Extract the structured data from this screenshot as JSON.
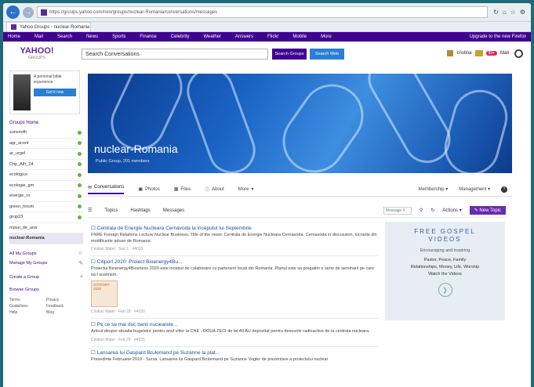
{
  "browser": {
    "url": "https://groups.yahoo.com/neo/groups/nuclear-Romania/conversations/messages",
    "tab_title": "Yahoo Groups - nuclear-Romania",
    "back_icon": "back-arrow-icon",
    "forward_icon": "forward-arrow-icon"
  },
  "ynav": {
    "items": [
      "Home",
      "Mail",
      "Search",
      "News",
      "Sports",
      "Finance",
      "Celebrity",
      "Weather",
      "Answers",
      "Flickr",
      "Mobile",
      "More"
    ],
    "right_text": "Upgrade to the new Firefox"
  },
  "header": {
    "logo": "YAHOO!",
    "logo_sub": "GROUPS",
    "search_value": "Search Conversations",
    "search_groups_label": "Search Groups",
    "search_web_label": "Search Web",
    "user_name": "cristina",
    "mail_count": "99+",
    "mail_label": "Mail"
  },
  "sidebar": {
    "ad_text": "A personal bible experience",
    "ad_button": "Get it now",
    "groups_heading": "Groups Home",
    "groups": [
      {
        "name": "sunsnoflr",
        "dot": true
      },
      {
        "name": "agr_aconf",
        "dot": true
      },
      {
        "name": "ar_urgel",
        "dot": true
      },
      {
        "name": "Cnp_Alfr_24",
        "dot": true
      },
      {
        "name": "ecologice",
        "dot": true
      },
      {
        "name": "ecologie_gm",
        "dot": true
      },
      {
        "name": "energie_ro",
        "dot": true
      },
      {
        "name": "green_forum",
        "dot": true
      },
      {
        "name": "grup23",
        "dot": true
      },
      {
        "name": "mpuri_de_ana",
        "dot": false
      },
      {
        "name": "nuclear-Romania",
        "dot": false,
        "active": true
      }
    ],
    "all_groups": "All My Groups",
    "manage_groups": "Manage My Groups",
    "create_group": "Create a Group",
    "browse_groups": "Browse Groups",
    "footer": [
      "Terms",
      "Privacy",
      "Guidelines",
      "Feedback",
      "Help",
      "Blog"
    ]
  },
  "cover": {
    "title": "nuclear-Romania",
    "meta": "Public Group, 201 members"
  },
  "main_tabs": {
    "items": [
      {
        "label": "Conversations",
        "icon": "conversations-icon",
        "active": true
      },
      {
        "label": "Photos",
        "icon": "camera-icon"
      },
      {
        "label": "Files",
        "icon": "files-icon"
      },
      {
        "label": "About",
        "icon": "info-icon"
      },
      {
        "label": "More",
        "icon": "chevron-down-icon"
      }
    ],
    "membership": "Membership",
    "management": "Management"
  },
  "toolbar": {
    "items": [
      "Topics",
      "Hashtags",
      "Messages"
    ],
    "search_placeholder": "Message #",
    "actions": "Actions",
    "new_topic": "New Topic"
  },
  "messages": [
    {
      "title": "Centrala de Energie Nucleara Cernavoda la inceputul lui Septembrie",
      "snippet": "FNRE Foreign Relations Lecture Nuclear Business, Title of the news: Centrala de Energie Nucleara Cernavoda. Cernavoda in discussion, lucrarile din modificarile aduse de Romania.",
      "meta": "Cristian Matei · Sep 1 · #4033"
    },
    {
      "title": "Citiport 2020: Proiect Bioenergy4Bu...",
      "snippet": "Proiectul Bioenergy4Business 2020 este inceput de colaborare cu partenerii locali din Romania. Planul este sa pregatim o serie de seminarii pe care sa-l sustinem.",
      "meta": "Cristian Matei · Feb 20 · #4032",
      "thumb": "CITIPORT 2020"
    },
    {
      "title": "Pe ce se mai duc banii nuclearele...",
      "snippet": "Articol despre situatia bugetelor pentru anul viitor la CNE - DOUA ZECI de lei 40 AU depozitat pentru deseurile radioactive de la centrala nucleara.",
      "meta": "Cristian Matei · Feb 20 · #4031"
    },
    {
      "title": "Lansarea lui Gaspard Brulemand pe Suzanne la plat...",
      "snippet": "Presedinte Februarie 2019 - Sursa: Lansarea lui Gaspard Brulemand pe Suzanne Vogler de prezentare a proiectului nuclear",
      "meta": ""
    }
  ],
  "right_ad": {
    "title_line1": "FREE GOSPEL",
    "title_line2": "VIDEOS",
    "sub": "Encouraging and inspiring",
    "line1": "Pastor, Peace, Family",
    "line2": "Relationships, Money, Life, Worship",
    "line3": "Watch the Videos",
    "play_icon": "play-icon"
  }
}
